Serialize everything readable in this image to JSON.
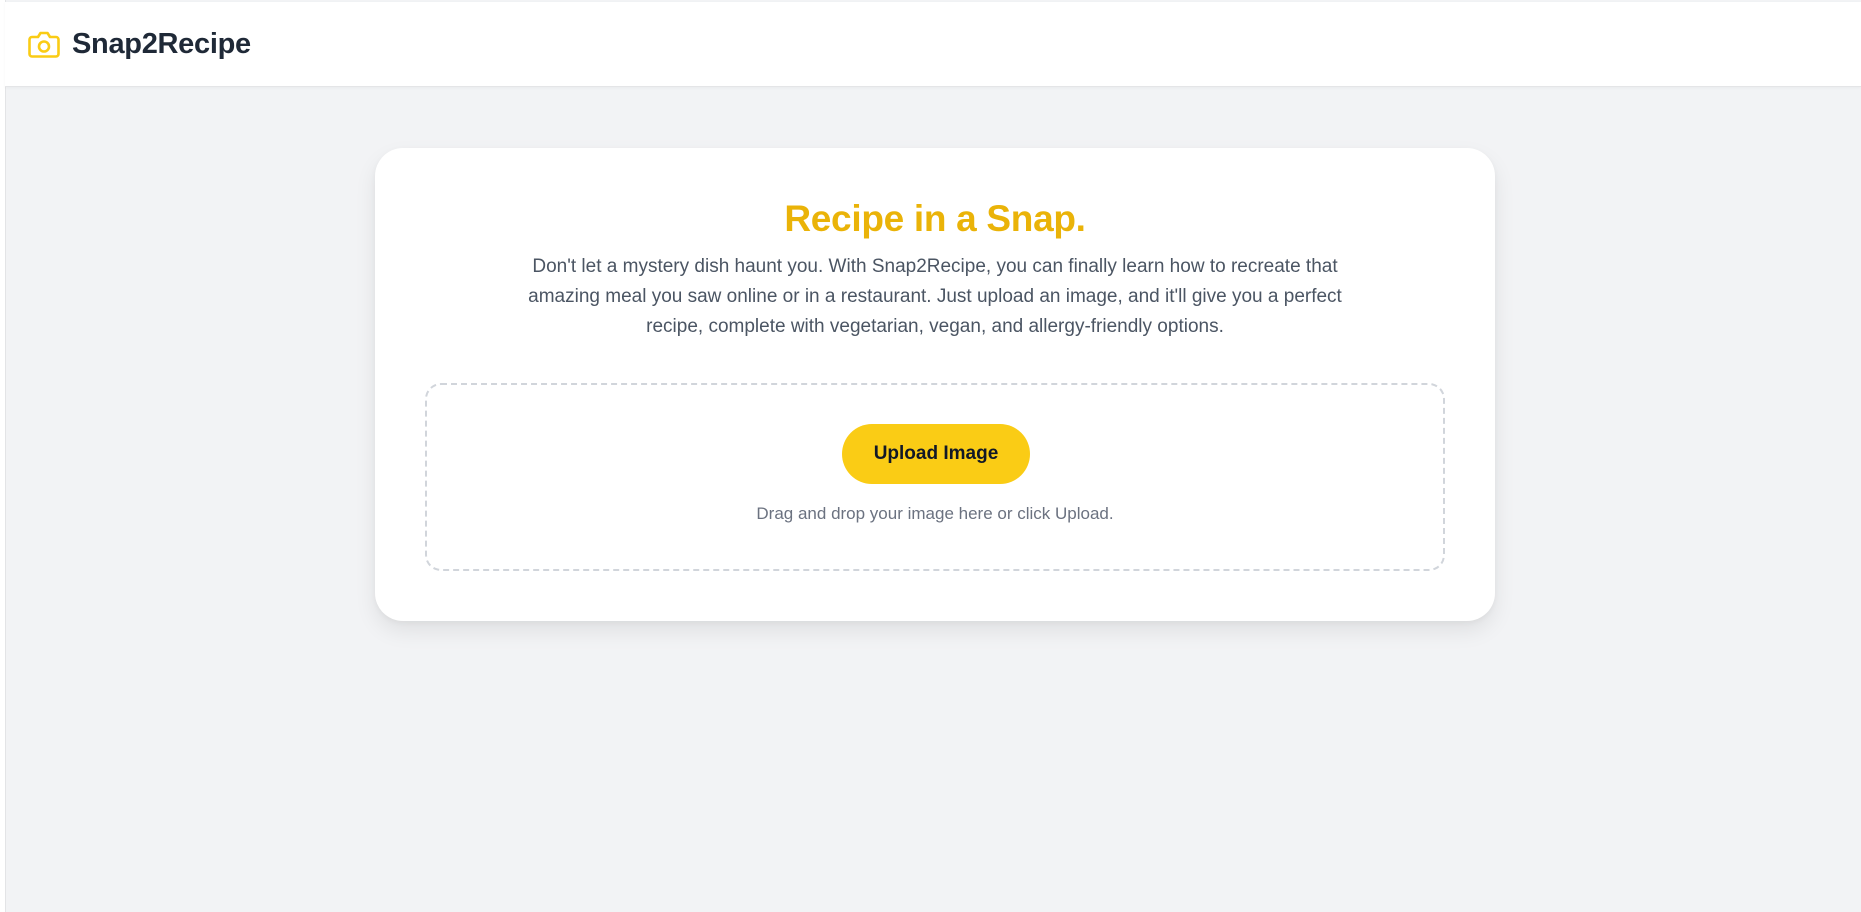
{
  "app": {
    "name": "Snap2Recipe",
    "brand_icon": "camera-icon",
    "accent_color": "#facc15",
    "title_color": "#eab308"
  },
  "hero": {
    "title": "Recipe in a Snap.",
    "description": "Don't let a mystery dish haunt you. With Snap2Recipe, you can finally learn how to recreate that amazing meal you saw online or in a restaurant. Just upload an image, and it'll give you a perfect recipe, complete with vegetarian, vegan, and allergy-friendly options."
  },
  "upload": {
    "button_label": "Upload Image",
    "hint": "Drag and drop your image here or click Upload."
  }
}
